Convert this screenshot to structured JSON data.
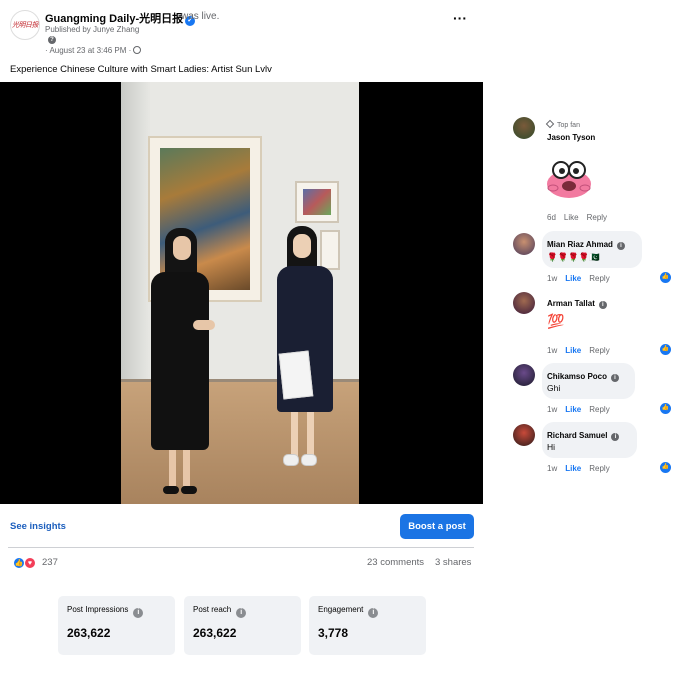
{
  "post": {
    "page_name": "Guangming Daily-光明日报",
    "status": "was live.",
    "published_by": "Published by Junye Zhang",
    "help_icon": "?",
    "timestamp": "· August 23 at 3:46 PM ·",
    "more_label": "···",
    "caption": "Experience Chinese Culture with Smart Ladies: Artist Sun Lvlv",
    "logo_text": "光明日报"
  },
  "actions": {
    "see_insights": "See insights",
    "boost": "Boost a post"
  },
  "engagement": {
    "reactions": "237",
    "comments": "23 comments",
    "shares": "3 shares"
  },
  "stats": [
    {
      "label": "Post Impressions",
      "value": "263,622"
    },
    {
      "label": "Post reach",
      "value": "263,622"
    },
    {
      "label": "Engagement",
      "value": "3,778"
    }
  ],
  "comments": [
    {
      "badge": "Top fan",
      "name": "Jason Tyson",
      "text": "",
      "time": "6d",
      "like": "Like",
      "reply": "Reply",
      "liked": false
    },
    {
      "name": "Mian Riaz Ahmad",
      "text": "🌹🌹🌹🌹🇵🇰",
      "time": "1w",
      "like": "Like",
      "reply": "Reply",
      "liked": true
    },
    {
      "name": "Arman Tallat",
      "text": "💯",
      "time": "1w",
      "like": "Like",
      "reply": "Reply",
      "liked": true
    },
    {
      "name": "Chikamso Poco",
      "text": "Ghi",
      "time": "1w",
      "like": "Like",
      "reply": "Reply",
      "liked": true
    },
    {
      "name": "Richard Samuel",
      "text": "Hi",
      "time": "1w",
      "like": "Like",
      "reply": "Reply",
      "liked": true
    }
  ],
  "colors": {
    "accent": "#1877f2",
    "boost": "#1b74e4",
    "link": "#1b5ebd",
    "card_bg": "#f0f2f5",
    "secondary_text": "#65676b"
  },
  "icons": [
    "verified-badge-icon",
    "help-icon",
    "globe-icon",
    "more-icon",
    "like-reaction-icon",
    "love-reaction-icon",
    "info-icon",
    "top-fan-icon",
    "profile-badge-icon",
    "like-mini-icon"
  ]
}
